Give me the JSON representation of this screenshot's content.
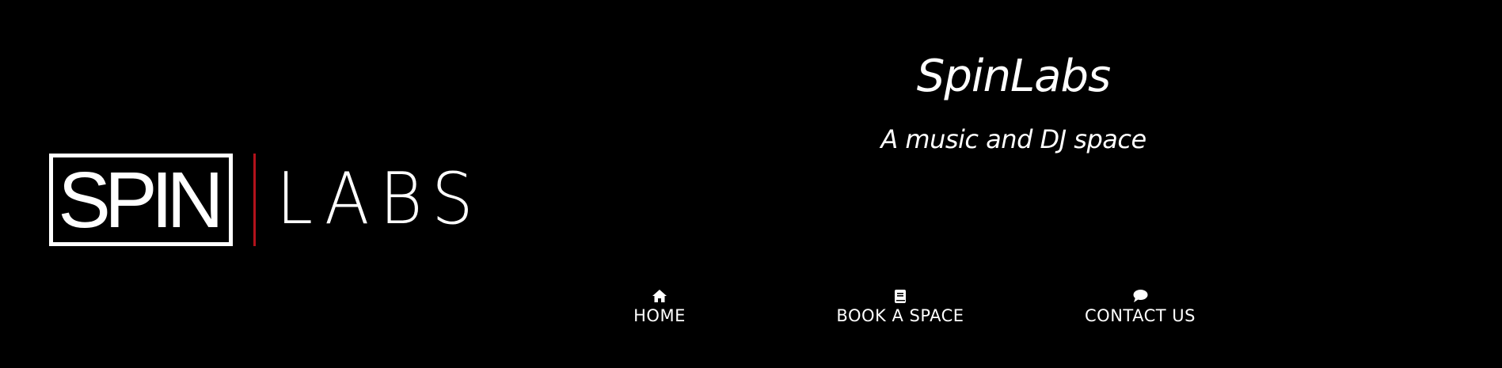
{
  "logo": {
    "boxed_text": "SPIN",
    "text": "LABS",
    "divider_color": "#b3121b"
  },
  "header": {
    "title": "SpinLabs",
    "tagline": "A music and DJ space"
  },
  "nav": {
    "items": [
      {
        "label": "HOME",
        "icon": "home-icon"
      },
      {
        "label": "BOOK A SPACE",
        "icon": "book-icon"
      },
      {
        "label": "CONTACT US",
        "icon": "speech-bubble-icon"
      }
    ]
  },
  "colors": {
    "background": "#000000",
    "text": "#ffffff",
    "accent": "#b3121b"
  }
}
